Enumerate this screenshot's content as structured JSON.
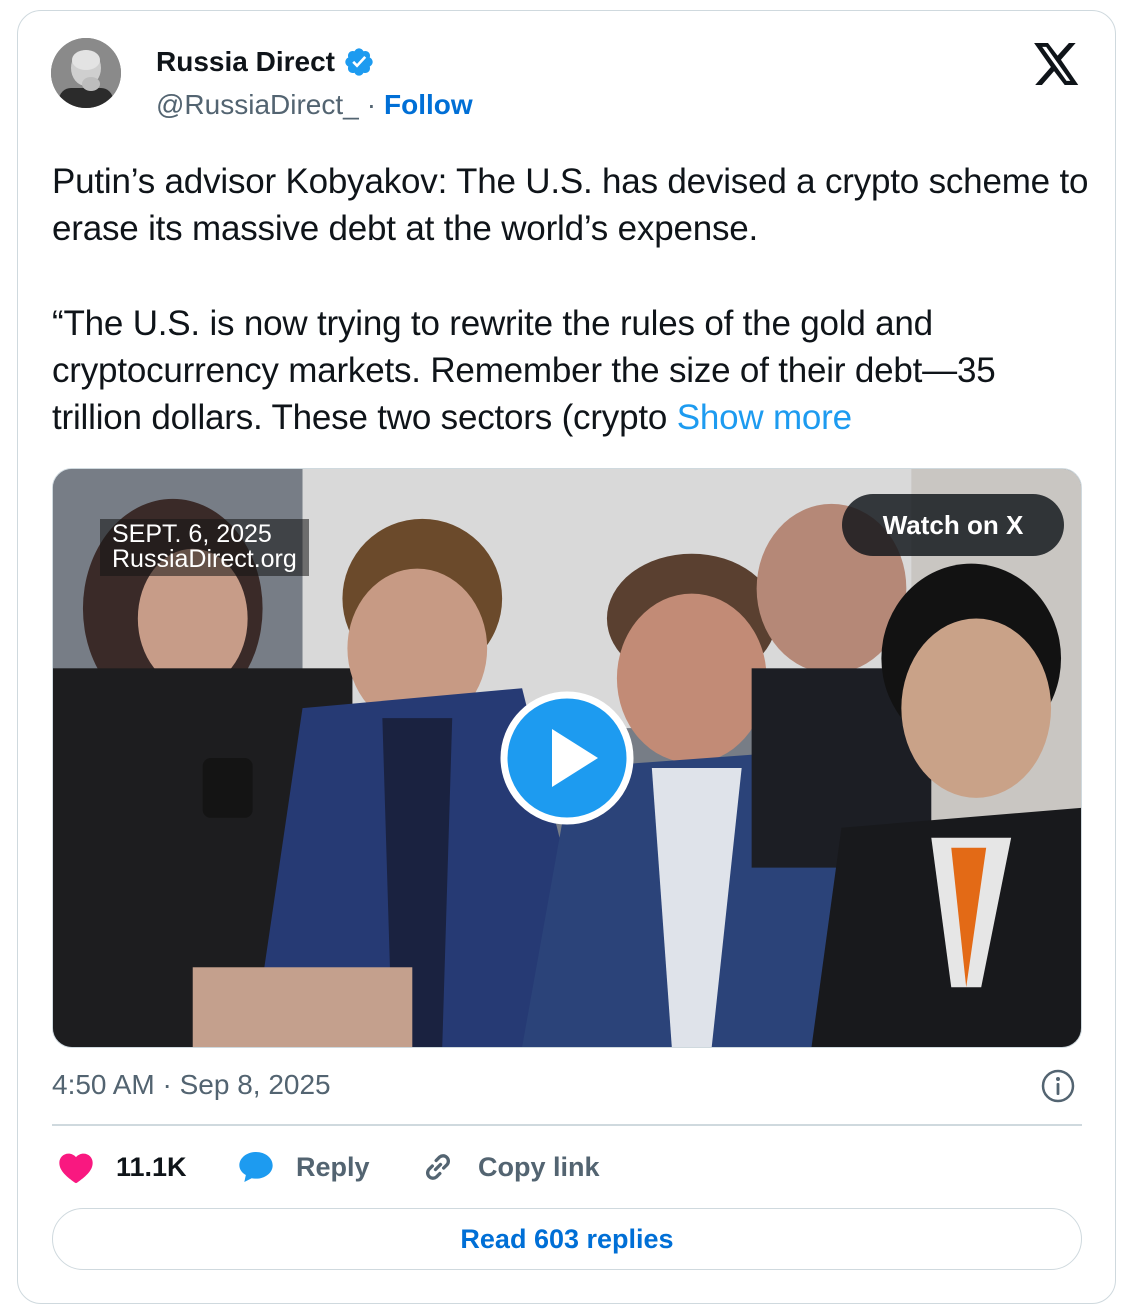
{
  "author": {
    "name": "Russia Direct",
    "handle": "@RussiaDirect_",
    "separator": "·",
    "follow_label": "Follow",
    "verified": true
  },
  "tweet": {
    "paragraph_1": "Putin’s advisor Kobyakov: The U.S. has devised a crypto scheme to erase its massive debt at the world’s expense.",
    "paragraph_2": "“The U.S. is now trying to rewrite the rules of the gold and cryptocurrency markets. Remember the size of their debt—35 trillion dollars. These two sectors (crypto",
    "show_more_label": "Show more"
  },
  "media": {
    "stamp_line_1": "SEPT. 6, 2025",
    "stamp_line_2": "RussiaDirect.org",
    "watch_label": "Watch on X"
  },
  "meta": {
    "timestamp": "4:50 AM · Sep 8, 2025"
  },
  "actions": {
    "likes": "11.1K",
    "reply_label": "Reply",
    "copy_label": "Copy link"
  },
  "read_replies_label": "Read 603 replies",
  "colors": {
    "link": "#006fd6",
    "show_more": "#1d9bf0",
    "like": "#f91880",
    "reply": "#1d9bf0",
    "muted": "#536471",
    "border": "#cfd9de"
  },
  "icons": [
    "verified-badge-icon",
    "x-logo-icon",
    "play-icon",
    "info-icon",
    "heart-icon",
    "reply-bubble-icon",
    "link-icon"
  ]
}
